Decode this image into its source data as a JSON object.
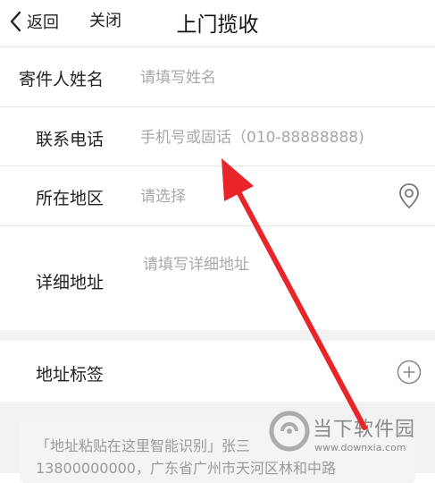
{
  "header": {
    "back_label": "返回",
    "close_label": "关闭",
    "title": "上门揽收"
  },
  "form": {
    "sender_name": {
      "label": "寄件人姓名",
      "placeholder": "请填写姓名",
      "value": ""
    },
    "phone": {
      "label": "联系电话",
      "placeholder": "手机号或固话（010-88888888)",
      "value": ""
    },
    "region": {
      "label": "所在地区",
      "placeholder": "请选择",
      "value": "",
      "icon": "location-pin-icon"
    },
    "address": {
      "label": "详细地址",
      "placeholder": "请填写详细地址",
      "value": ""
    },
    "address_tag": {
      "label": "地址标签",
      "icon": "plus-circle-icon"
    }
  },
  "paste_area": {
    "text": "「地址粘贴在这里智能识别」张三\n13800000000，广东省广州市天河区林和中路"
  },
  "watermark": {
    "name": "当下软件园",
    "url": "www.downxia.com"
  },
  "annotation": {
    "type": "red-arrow",
    "color": "#e8262a",
    "points_to": "phone-field"
  },
  "colors": {
    "background": "#ffffff",
    "divider": "#e6e6e6",
    "section_gap": "#f2f2f2",
    "placeholder": "#a8a8a8",
    "text": "#222222"
  }
}
